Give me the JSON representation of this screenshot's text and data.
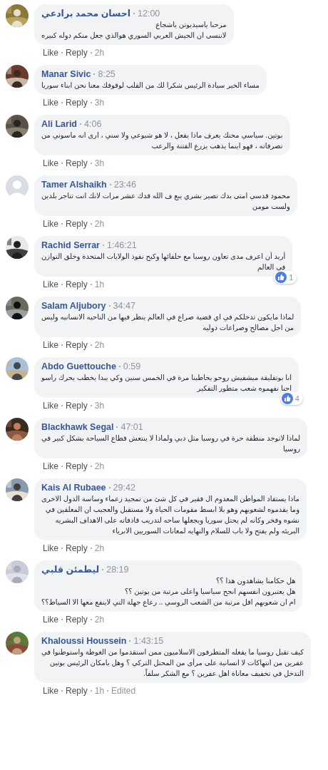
{
  "comments": [
    {
      "author": "احسان محمد برادعي",
      "time": "12:00",
      "text": "مرحبا ياسيديوتن ياشجاع\nلاننسى ان الجيش العربي السوري هوالذي جعل منكم دوله كبيره",
      "like": "Like",
      "reply": "Reply",
      "age": "2h"
    },
    {
      "author": "Manar Sivic",
      "time": "8:25",
      "text": "مساء الخير سيادة الرئيس شكرا لك من القلب لوقوفك معنا نحن ابناء سوريا",
      "like": "Like",
      "reply": "Reply",
      "age": "3h"
    },
    {
      "author": "Ali Larid",
      "time": "4:06",
      "text": "بوتين. سياسي محنك يعرف ماذا يفعل ، لا هو شيوعي ولا سني ، ارى انه ماسوني من\nتصرفاته ، فهو اينما يذهب يزرع الفتنة والرعب",
      "like": "Like",
      "reply": "Reply",
      "age": "3h"
    },
    {
      "avatar": {
        "kind": "default"
      },
      "author": "Tamer Alshaikh",
      "time": "23:46",
      "text": "محمود قدسي امتى بدك تصير بشري يبع ف الله قدك عشر مرات لانك انت تتاجر بلدين\nولست مومن",
      "like": "Like",
      "reply": "Reply",
      "age": "2h"
    },
    {
      "author": "Rachid Serrar",
      "time": "1:46:21",
      "text": "أريد أن اعرف مدى تعاون روسيا مع حلفائها وكبح نفوذ الولايات المتحدة وخلق التوازن\nفي العالم",
      "like": "Like",
      "reply": "Reply",
      "age": "1h",
      "reactions": "1"
    },
    {
      "author": "Salam Aljubory",
      "time": "34:47",
      "text": "لماذا مايكون تدخلكم في اي قضية صراع في العالم ينظر فيها من الناحيه الانسانيه وليس\nمن اجل مصالح وصراعات دوليه",
      "like": "Like",
      "reply": "Reply",
      "age": "2h"
    },
    {
      "author": "Abdo Guettouche",
      "time": "0:59",
      "text": "انا بوتفليقة ميشفيش روحو يخاطبنا مرة في الخمس سنين وكي يبدا يخطب يحرك راسو\nاحنا نفهموه شعب متطور التفكير",
      "like": "Like",
      "reply": "Reply",
      "age": "3h",
      "reactions": "4"
    },
    {
      "author": "Blackhawk Segal",
      "time": "47:01",
      "text": "لماذا لاتوجد منطقة حرة في روسيا مثل دبي ولماذا لا ينتعش قطاع السياحة بشكل كبير في\nروسيا",
      "like": "Like",
      "reply": "Reply",
      "age": "2h"
    },
    {
      "author": "Kais Al Rubaee",
      "time": "29:42",
      "text": "ماذا يستفاد المواطن المعدوم ال فقير في كل شئ من تمجيد زعماء وساسة الدول الاخرى\nوما يقدموه لشعوبهم وهو بلا ابسط مقومات الحياة ولا مستقبل والعجيب ان المعلقين في\nنشوه وفخر وكانه لم يحتل سوريا ويجعلها ساحه لتدريب قاذفاته على الاهداف البشريه\nالبريئه ولم يفتح ولا باب للسلام والنهايه لمعانات السوريين الابرياء",
      "like": "Like",
      "reply": "Reply",
      "age": "2h"
    },
    {
      "author": "ليطمئن قلبي",
      "time": "28:19",
      "text": "هل حكامنا يشاهدون هذا ؟؟\nهل يعتبرون انفسهم انجح سياسيا واعلى مرتبة من بوتين ؟؟\nام ان شعوبهم اقل مرتبة من الشعب الروسي .. رعاع جهلة التي لاينفع معها الا السياط؟؟",
      "like": "Like",
      "reply": "Reply",
      "age": "2h"
    },
    {
      "author": "Khaloussi Houssein",
      "time": "1:43:15",
      "text": "كيف تقبل روسيا ما يفعله المتطرفون الاسلاميون ممن استقدموا من الغوطة واستوطنوا في\nعفرين من انتهاكات لا انسانية على مرأى من المحتل التركي ؟ وهل بامكان الرئيس بوتين\nالتدخل في تخفيف معاناة اهل عفرين ؟ مع الشكر سلفاً.",
      "like": "Like",
      "reply": "Reply",
      "age": "1h",
      "edited": "Edited"
    }
  ]
}
